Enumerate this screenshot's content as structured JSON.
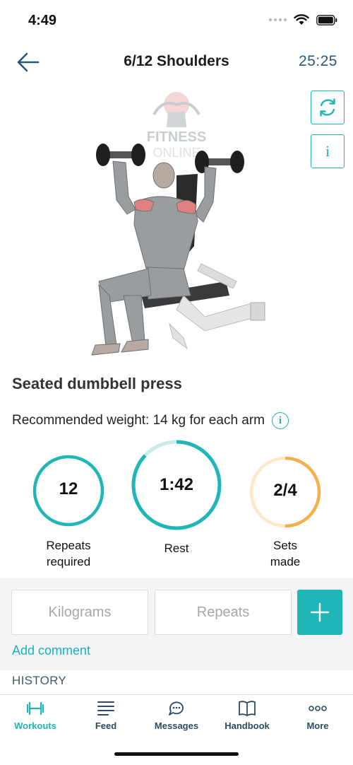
{
  "status": {
    "time": "4:49"
  },
  "nav": {
    "title": "6/12 Shoulders",
    "timer": "25:25"
  },
  "logo": {
    "line1": "FITNESS",
    "line2": "ONLINE"
  },
  "exercise": {
    "name": "Seated dumbbell press",
    "recommended_weight": "Recommended weight: 14 kg for each arm"
  },
  "stats": {
    "repeats": {
      "value": "12",
      "label_line1": "Repeats",
      "label_line2": "required",
      "color": "#1eb6b6"
    },
    "rest": {
      "value": "1:42",
      "label": "Rest",
      "progress": 0.87,
      "color": "#1eb6b6",
      "track_color": "#c7ecea"
    },
    "sets": {
      "value": "2/4",
      "label_line1": "Sets",
      "label_line2": "made",
      "progress": 0.5,
      "color": "#f6b04a",
      "track_color": "#fde9c9"
    }
  },
  "inputs": {
    "kilograms_placeholder": "Kilograms",
    "repeats_placeholder": "Repeats"
  },
  "add_comment": "Add comment",
  "history": "HISTORY",
  "tabs": [
    {
      "label": "Workouts",
      "icon": "dumbbell-icon",
      "active": true
    },
    {
      "label": "Feed",
      "icon": "feed-icon"
    },
    {
      "label": "Messages",
      "icon": "messages-icon"
    },
    {
      "label": "Handbook",
      "icon": "book-icon"
    },
    {
      "label": "More",
      "icon": "more-icon"
    }
  ],
  "colors": {
    "accent": "#1eb6b6",
    "nav_text": "#2d4a63",
    "sets_orange": "#f6b04a"
  }
}
